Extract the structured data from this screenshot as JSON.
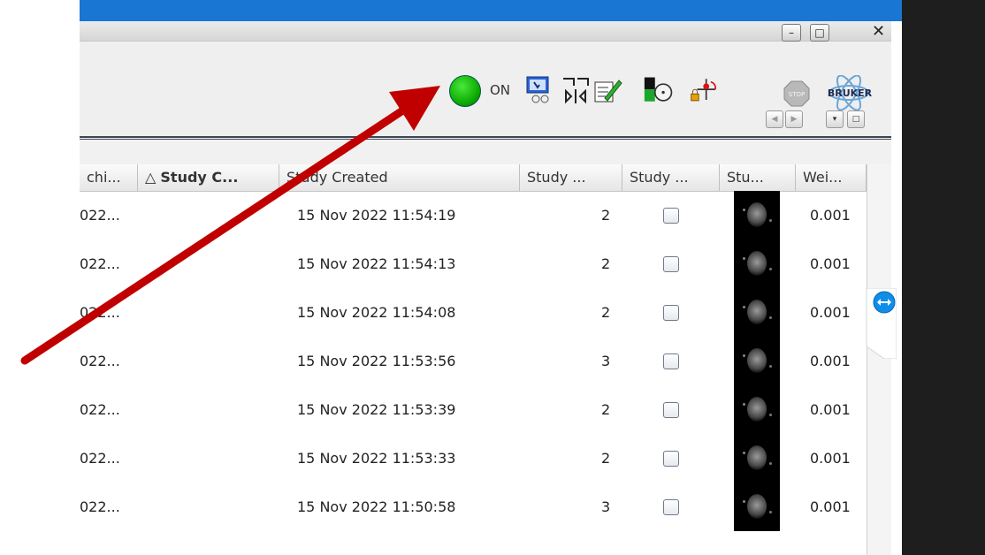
{
  "toolbar": {
    "status_label": "ON",
    "status_color": "#1bc10f",
    "icons": [
      "acquisition-display-icon",
      "spectrometer-icon",
      "edit-parameters-icon",
      "sample-disk-icon",
      "gradient-lock-icon"
    ],
    "stop_label": "STOP",
    "brand": "BRUKER"
  },
  "window_buttons": {
    "minimize": "–",
    "restore": "□",
    "close": "✕"
  },
  "nav": {
    "prev": "◀",
    "next": "▶",
    "menu": "▾",
    "restore": "□"
  },
  "table": {
    "columns": [
      "chi...",
      "Study C...",
      "Study Created",
      "Study ...",
      "Study ...",
      "Stu...",
      "Wei..."
    ],
    "sort_indicator": "△",
    "rows": [
      {
        "c0": "022...",
        "created": "15 Nov 2022 11:54:19",
        "num": "2",
        "weight": "0.001"
      },
      {
        "c0": "022...",
        "created": "15 Nov 2022 11:54:13",
        "num": "2",
        "weight": "0.001"
      },
      {
        "c0": "022...",
        "created": "15 Nov 2022 11:54:08",
        "num": "2",
        "weight": "0.001"
      },
      {
        "c0": "022...",
        "created": "15 Nov 2022 11:53:56",
        "num": "3",
        "weight": "0.001"
      },
      {
        "c0": "022...",
        "created": "15 Nov 2022 11:53:39",
        "num": "2",
        "weight": "0.001"
      },
      {
        "c0": "022...",
        "created": "15 Nov 2022 11:53:33",
        "num": "2",
        "weight": "0.001"
      },
      {
        "c0": "022...",
        "created": "15 Nov 2022 11:50:58",
        "num": "3",
        "weight": "0.001"
      }
    ]
  },
  "colors": {
    "title_bar": "#1976d2",
    "arrow": "#c00000",
    "separator": "#3c4652"
  }
}
